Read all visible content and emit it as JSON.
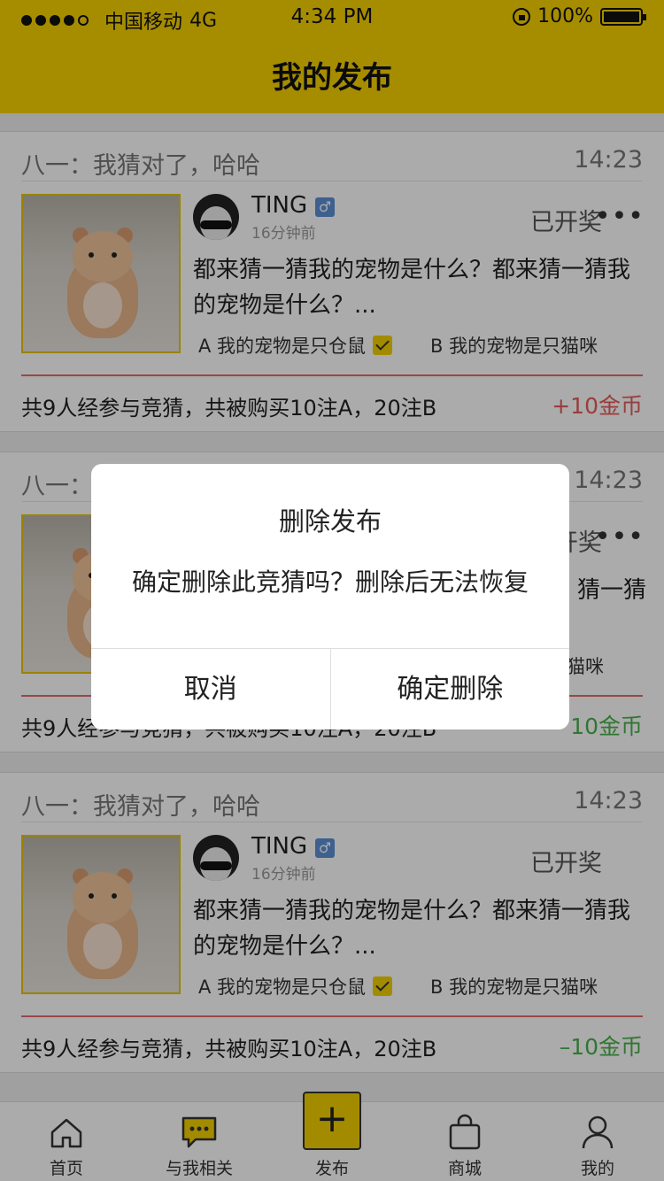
{
  "status_bar": {
    "carrier": "中国移动",
    "network": "4G",
    "time": "4:34 PM",
    "battery": "100%"
  },
  "header": {
    "title": "我的发布"
  },
  "cards": [
    {
      "message": "八一：我猜对了，哈哈",
      "time": "14:23",
      "username": "TING",
      "gender_symbol": "♂",
      "ago": "16分钟前",
      "state": "已开奖",
      "more": "•••",
      "question": "都来猜一猜我的宠物是什么？都来猜一猜我的宠物是什么？...",
      "option_a": "A 我的宠物是只仓鼠",
      "option_b": "B 我的宠物是只猫咪",
      "summary": "共9人经参与竞猜，共被购买10注A，20注B",
      "reward": "+10金币",
      "reward_color": "#e45b5b"
    },
    {
      "message": "八一：",
      "time": "14:23",
      "state": "开奖",
      "more": "•••",
      "question": "猜一猜",
      "option_b": "猫咪",
      "summary": "共9人经参与竞猜，共被购买10注A，20注B",
      "reward": "10金币",
      "reward_color": "#49b14b"
    },
    {
      "message": "八一：我猜对了，哈哈",
      "time": "14:23",
      "username": "TING",
      "gender_symbol": "♂",
      "ago": "16分钟前",
      "state": "已开奖",
      "question": "都来猜一猜我的宠物是什么？都来猜一猜我的宠物是什么？...",
      "option_a": "A 我的宠物是只仓鼠",
      "option_b": "B 我的宠物是只猫咪",
      "summary": "共9人经参与竞猜，共被购买10注A，20注B",
      "reward": "–10金币",
      "reward_color": "#49b14b"
    }
  ],
  "dialog": {
    "title": "删除发布",
    "message": "确定删除此竞猜吗？删除后无法恢复",
    "cancel": "取消",
    "confirm": "确定删除"
  },
  "tabbar": {
    "items": [
      {
        "label": "首页",
        "icon": "home-icon"
      },
      {
        "label": "与我相关",
        "icon": "chat-icon"
      },
      {
        "label": "发布",
        "icon": "plus-icon"
      },
      {
        "label": "商城",
        "icon": "bag-icon"
      },
      {
        "label": "我的",
        "icon": "person-icon"
      }
    ],
    "accent": "#f3cf00"
  }
}
